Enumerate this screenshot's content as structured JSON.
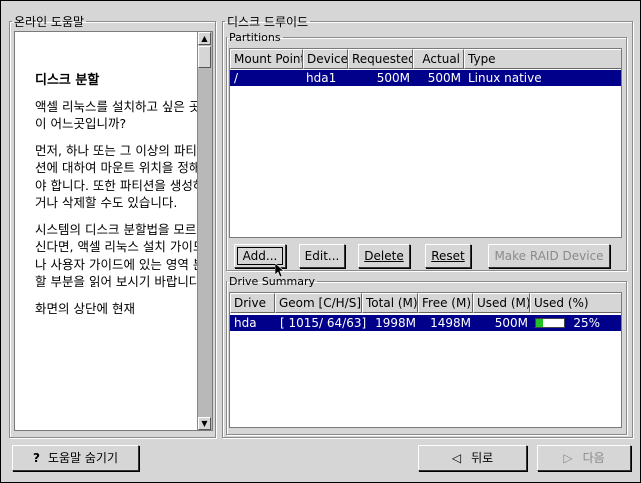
{
  "help": {
    "title": "온라인 도움말",
    "heading": "디스크 분할",
    "paragraphs": [
      "액셀 리눅스를 설치하고 싶은 곳이 어느곳입니까?",
      "먼저, 하나 또는 그 이상의 파티션에 대하여 마운트 위치을 정해야 합니다. 또한 파티션을 생성하거나 삭제할 수도 있습니다.",
      "시스템의 디스크 분할법을 모르신다면, 액셀 리눅스 설치 가이드나 사용자 가이드에 있는 영역 분할 부분을 읽어 보시기 바랍니다.",
      "화면의 상단에 현재"
    ]
  },
  "druid": {
    "title": "디스크 드루이드"
  },
  "partitions": {
    "title": "Partitions",
    "columns": [
      "Mount Point",
      "Device",
      "Requested",
      "Actual",
      "Type"
    ],
    "rows": [
      {
        "mount": "/",
        "device": "hda1",
        "requested": "500M",
        "actual": "500M",
        "type": "Linux native"
      }
    ],
    "buttons": {
      "add": "Add...",
      "edit": "Edit...",
      "delete": "Delete",
      "reset": "Reset",
      "raid": "Make RAID Device"
    }
  },
  "summary": {
    "title": "Drive Summary",
    "columns": [
      "Drive",
      "Geom [C/H/S]",
      "Total (M)",
      "Free (M)",
      "Used (M)",
      "Used (%)"
    ],
    "rows": [
      {
        "drive": "hda",
        "geom": "[ 1015/ 64/63]",
        "total": "1998M",
        "free": "1498M",
        "used": "500M",
        "used_pct": "25%",
        "used_fraction": 0.25
      }
    ]
  },
  "bottom": {
    "hide_help": "도움말 숨기기",
    "back": "뒤로",
    "next": "다음"
  },
  "colors": {
    "selection": "#00008b",
    "usage_bar": "#22c022"
  }
}
